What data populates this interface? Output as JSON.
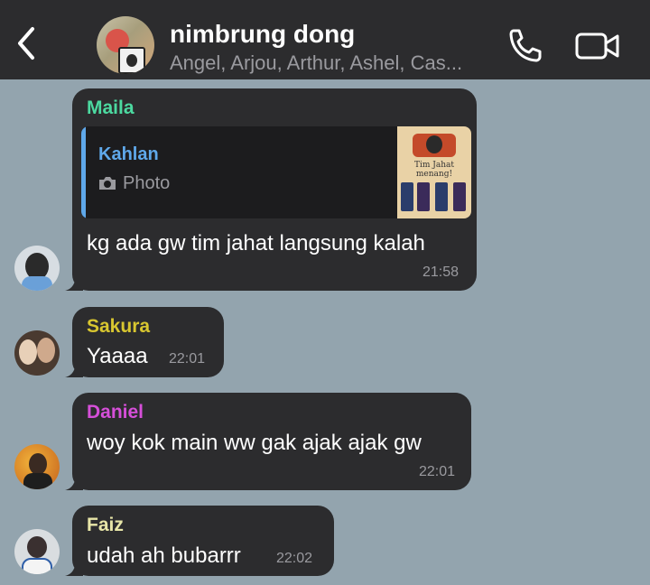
{
  "header": {
    "title": "nimbrung dong",
    "members": "Angel, Arjou, Arthur, Ashel, Cas..."
  },
  "messages": [
    {
      "sender": "Maila",
      "sender_color": "#4cd9a0",
      "reply": {
        "name": "Kahlan",
        "type": "Photo",
        "thumb_text": "Tim Jahat menang!"
      },
      "text": "kg ada gw tim jahat langsung kalah",
      "time": "21:58"
    },
    {
      "sender": "Sakura",
      "sender_color": "#d8c630",
      "text": "Yaaaa",
      "time": "22:01"
    },
    {
      "sender": "Daniel",
      "sender_color": "#d64fd9",
      "text": "woy kok main ww gak ajak ajak gw",
      "time": "22:01"
    },
    {
      "sender": "Faiz",
      "sender_color": "#e8e6a8",
      "text": "udah ah bubarrr",
      "time": "22:02"
    }
  ],
  "icons": {
    "back": "chevron-left-icon",
    "call": "phone-icon",
    "video": "video-camera-icon",
    "photo": "camera-icon"
  },
  "colors": {
    "chat_background": "#93a4ae",
    "bubble": "#2c2c2e",
    "reply_accent": "#5fa8ea"
  }
}
